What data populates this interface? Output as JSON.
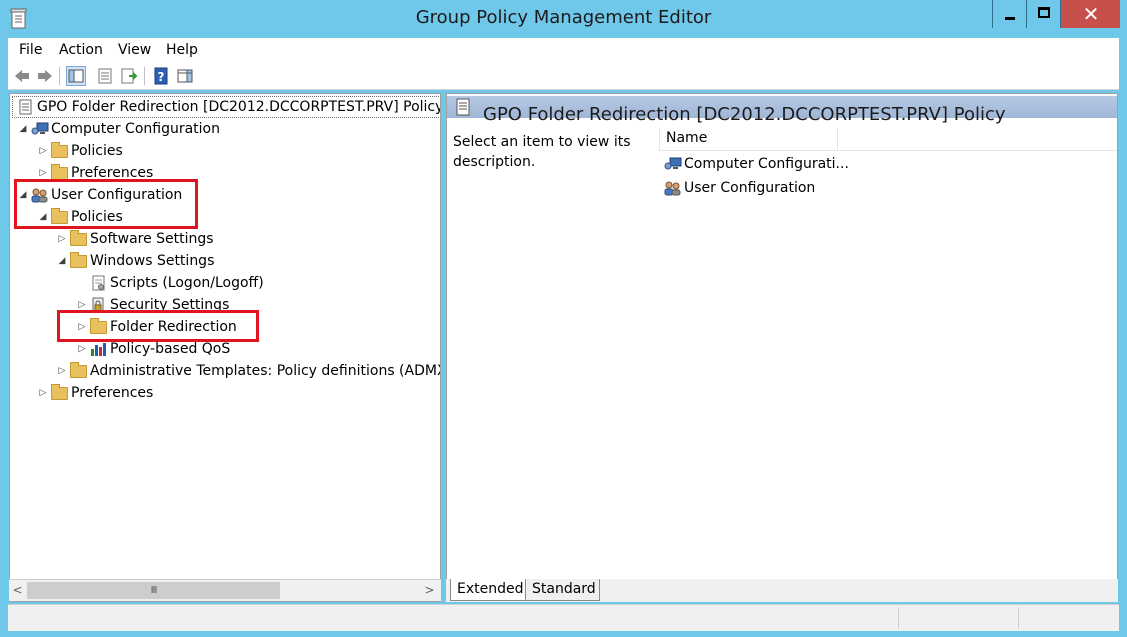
{
  "window": {
    "title": "Group Policy Management Editor",
    "close_glyph": "✕"
  },
  "menu": {
    "file": "File",
    "action": "Action",
    "view": "View",
    "help": "Help"
  },
  "toolbar": {
    "icons": [
      "back-arrow-icon",
      "forward-arrow-icon",
      "show-hide-tree-icon",
      "properties-icon",
      "export-list-icon",
      "help-icon",
      "show-hide-action-pane-icon"
    ]
  },
  "tree": {
    "root": "GPO Folder Redirection [DC2012.DCCORPTEST.PRV] Policy",
    "computer_configuration": "Computer Configuration",
    "cc_policies": "Policies",
    "cc_preferences": "Preferences",
    "user_configuration": "User Configuration",
    "uc_policies": "Policies",
    "software_settings": "Software Settings",
    "windows_settings": "Windows Settings",
    "scripts": "Scripts (Logon/Logoff)",
    "security_settings": "Security Settings",
    "folder_redirection": "Folder Redirection",
    "policy_qos": "Policy-based QoS",
    "admin_templates": "Administrative Templates: Policy definitions (ADMX f",
    "uc_preferences": "Preferences",
    "expanded_glyph": "◢",
    "collapsed_glyph": "▷"
  },
  "scrollbar": {
    "left_arrow": "<",
    "right_arrow": ">",
    "thumb_grip": "III"
  },
  "right_pane": {
    "header": "GPO Folder Redirection [DC2012.DCCORPTEST.PRV] Policy",
    "description": "Select an item to view its description.",
    "column_name": "Name",
    "items": [
      "Computer Configurati...",
      "User Configuration"
    ]
  },
  "tabs": {
    "extended": "Extended",
    "standard": "Standard"
  },
  "colors": {
    "title_bar": "#6fc8ea",
    "highlight": "#e0151f",
    "close_button": "#c7504a"
  }
}
